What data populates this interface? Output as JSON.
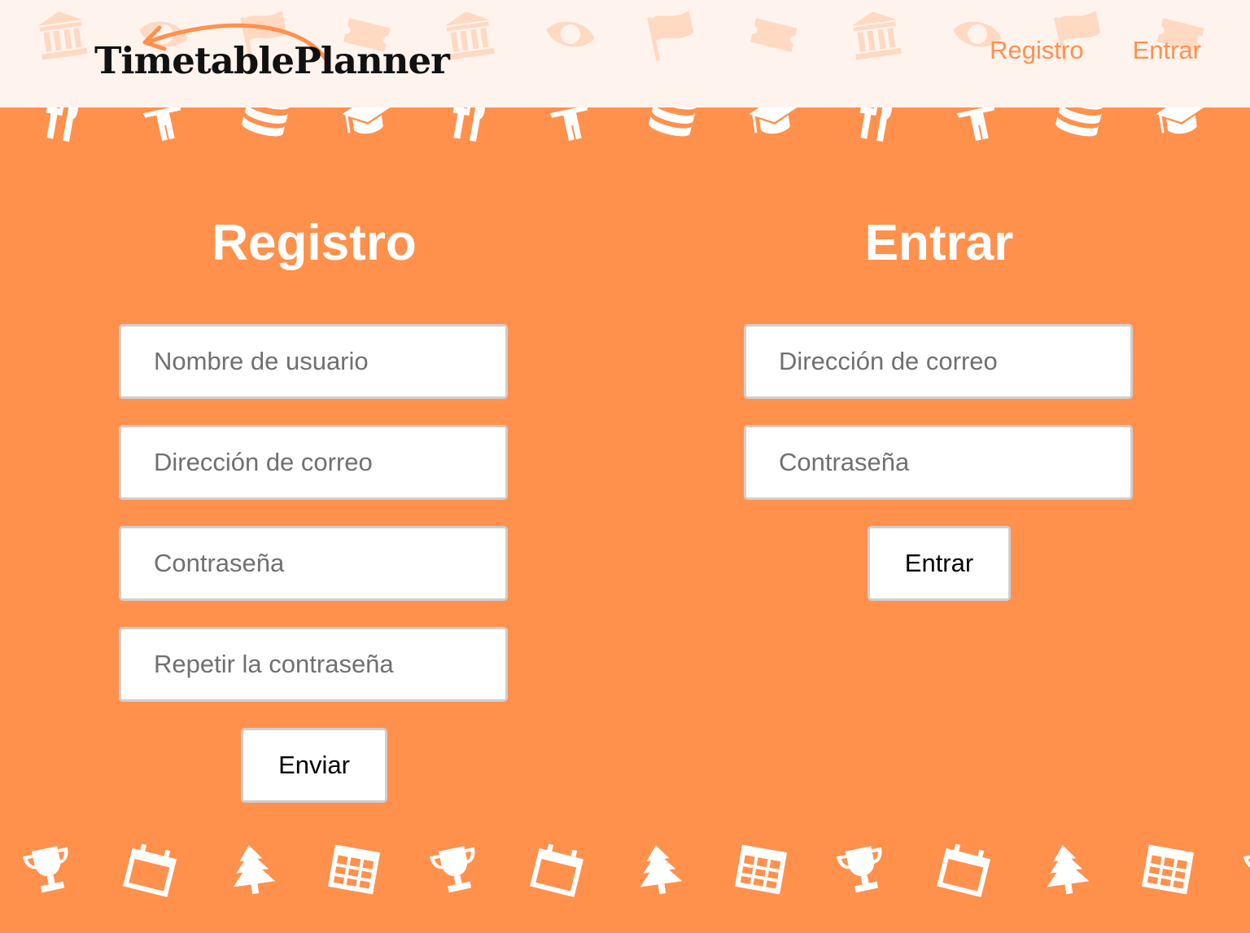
{
  "header": {
    "logo_text": "TimetablePlanner",
    "nav": {
      "register": "Registro",
      "login": "Entrar"
    }
  },
  "register": {
    "title": "Registro",
    "fields": {
      "username": "Nombre de usuario",
      "email": "Dirección de correo",
      "password": "Contraseña",
      "repeat_password": "Repetir la contraseña"
    },
    "submit": "Enviar"
  },
  "login": {
    "title": "Entrar",
    "fields": {
      "email": "Dirección de correo",
      "password": "Contraseña"
    },
    "submit": "Entrar"
  },
  "background_icons": {
    "header_row": [
      "bank-icon",
      "eye-icon",
      "flag-icon",
      "ticket-icon"
    ],
    "top_row": [
      "utensils-icon",
      "person-icon",
      "database-icon",
      "graduation-cap-icon"
    ],
    "bottom_row": [
      "trophy-icon",
      "calendar-icon",
      "tree-icon",
      "grid-icon"
    ]
  },
  "colors": {
    "accent": "#ff914d",
    "header_bg": "#fff3ee",
    "field_border": "#cfcfcf"
  }
}
